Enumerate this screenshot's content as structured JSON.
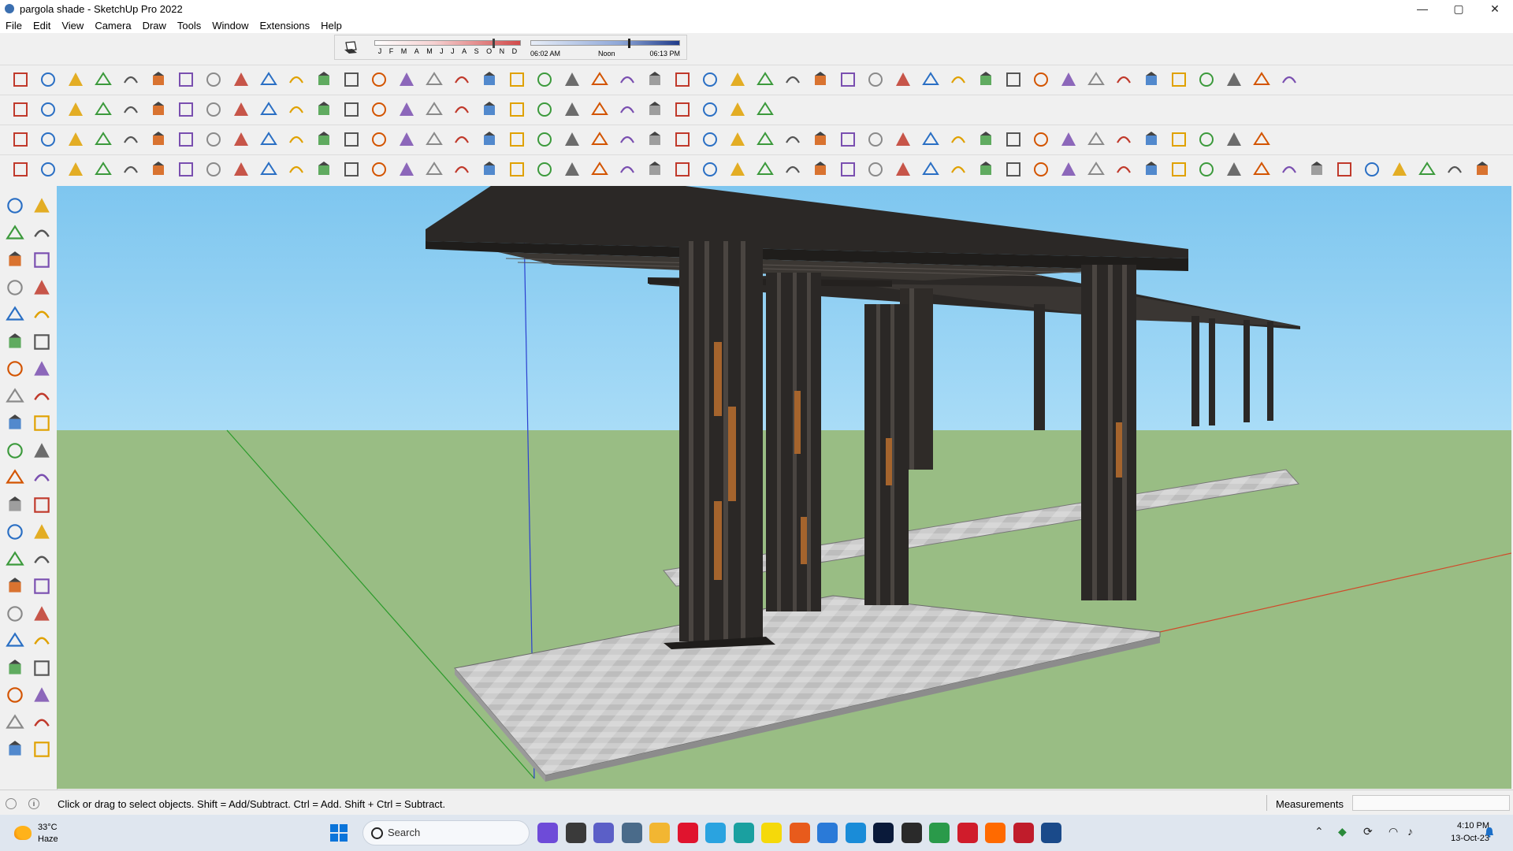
{
  "window": {
    "title": "pargola shade - SketchUp Pro 2022",
    "controls": {
      "minimize": "—",
      "maximize": "▢",
      "close": "✕"
    }
  },
  "menu": [
    "File",
    "Edit",
    "View",
    "Camera",
    "Draw",
    "Tools",
    "Window",
    "Extensions",
    "Help"
  ],
  "shadow": {
    "months": [
      "J",
      "F",
      "M",
      "A",
      "M",
      "J",
      "J",
      "A",
      "S",
      "O",
      "N",
      "D"
    ],
    "sunrise": "06:02 AM",
    "noon": "Noon",
    "sunset": "06:13 PM"
  },
  "toolbar_icons": {
    "row1": [
      "freehand",
      "arc-2pt",
      "pie",
      "tape",
      "polygon-3d",
      "rotated-rect",
      "follow-me",
      "intersect",
      "section-cut",
      "dim",
      "arrow-tool",
      "line-offset",
      "diagonal",
      "wall",
      "roof",
      "glazing",
      "stair",
      "rail",
      "column",
      "slab",
      "panel",
      "beam",
      "shape-bend",
      "joint-push",
      "joint-pull",
      "fillet",
      "chamfer",
      "round-corner",
      "truss",
      "grid",
      "curtain",
      "window-tool",
      "door-tool",
      "hatch",
      "stripes",
      "louvers",
      "spiral",
      "helix",
      "fan",
      "wave",
      "sphere",
      "warehouse",
      "shed",
      "house",
      "garage",
      "home",
      "barn"
    ],
    "row2": [
      "zoom",
      "select",
      "eraser",
      "pencil",
      "lasso",
      "paint",
      "push",
      "follow",
      "move",
      "rotate",
      "scale",
      "tape",
      "text",
      "paint-bucket",
      "orbit",
      "pan",
      "zoom2",
      "zoom-ext",
      "component",
      "sandbox",
      "stamp",
      "drape",
      "styles",
      "hide",
      "flip",
      "stack",
      "lamp",
      "solar"
    ],
    "row3": [
      "move-tool",
      "cube",
      "cube2",
      "texture",
      "table",
      "rooms",
      "array",
      "select-all",
      "bucket",
      "paint-2",
      "loop",
      "circle-3",
      "oval",
      "ellipse",
      "slab-2",
      "arch",
      "torus",
      "fence",
      "hexagon",
      "pipe",
      "ruler",
      "erase-paint",
      "section",
      "section-2",
      "section-3",
      "layers-1",
      "layers-2",
      "sphere-a",
      "sphere-b",
      "pulley-1",
      "pulley-2",
      "pulley-3",
      "refresh",
      "stairs-2",
      "frame",
      "frame-2",
      "frame-3",
      "frame-4",
      "frame-5",
      "brick-1",
      "brick-2",
      "roof-1",
      "roof-2",
      "roof-3",
      "roof-4",
      "roof-5"
    ],
    "row4": [
      "solar-panel",
      "canopy",
      "ring",
      "sextant",
      "burst",
      "dome",
      "sphere-outline",
      "union",
      "subtract",
      "grid-1",
      "box-1",
      "box-2",
      "circle-4",
      "circle-5",
      "hand",
      "plane-blue",
      "plane-blue-2",
      "plane-yellow",
      "plane-green",
      "plane-red",
      "plane-gray",
      "curve",
      "red-box",
      "shelf",
      "page",
      "crate",
      "chain",
      "corner",
      "path",
      "move-red",
      "move-green",
      "scale-blue",
      "cone",
      "pyramid",
      "triangle",
      "lasso-2",
      "lasso-3",
      "lasso-4",
      "axes",
      "bin",
      "undo",
      "tree",
      "pump",
      "cube-red",
      "cube-stack",
      "cube-mix",
      "cube-grid",
      "window-frame",
      "tile-1",
      "tile-2",
      "tile-3",
      "cross",
      "dot-arc",
      "component-tree"
    ]
  },
  "status": {
    "hint": "Click or drag to select objects. Shift = Add/Subtract. Ctrl = Add. Shift + Ctrl = Subtract.",
    "measurements_label": "Measurements"
  },
  "taskbar": {
    "temp": "33°C",
    "condition": "Haze",
    "search_placeholder": "Search",
    "time": "4:10 PM",
    "date": "13-Oct-23"
  },
  "colors": {
    "sky": "#8fcff3",
    "ground": "#99bd84",
    "structure": "#2b2826",
    "wood": "#a5642d",
    "paving": "#c9c9c9",
    "axis_red": "#d04a2a",
    "axis_green": "#2a9a2a",
    "axis_blue": "#2a3fd0"
  }
}
